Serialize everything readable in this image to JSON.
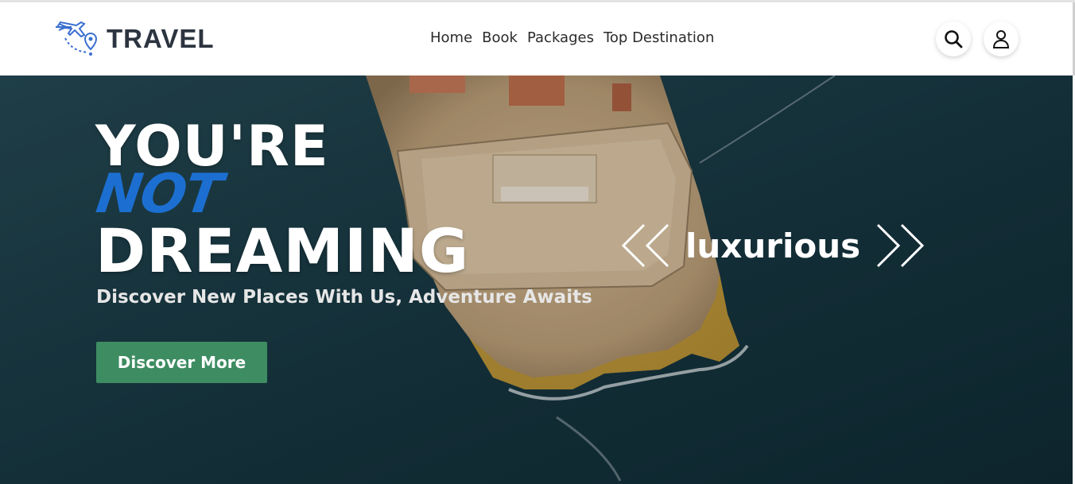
{
  "brand": {
    "name": "TRAVEL",
    "logo_icon": "plane-location-icon",
    "accent": "#3b6fd0"
  },
  "nav": {
    "links": [
      {
        "label": "Home"
      },
      {
        "label": "Book"
      },
      {
        "label": "Packages"
      },
      {
        "label": "Top Destination"
      }
    ]
  },
  "actions": {
    "search_icon": "search-icon",
    "account_icon": "user-icon"
  },
  "hero": {
    "headline_line1": "YOU'RE",
    "headline_line2": "NOT",
    "headline_line3": "DREAMING",
    "subtitle": "Discover New Places With Us, Adventure Awaits",
    "cta_label": "Discover More",
    "cta_color": "#3e8c62",
    "not_color": "#1c6fd1",
    "slide_label": "luxurious",
    "prev_icon": "double-chevron-left-icon",
    "next_icon": "double-chevron-right-icon"
  }
}
